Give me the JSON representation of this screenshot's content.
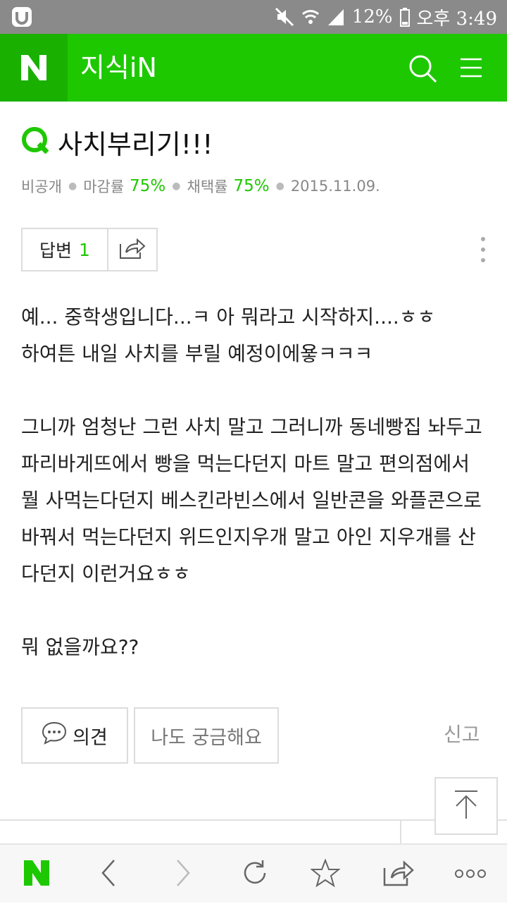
{
  "status_bar": {
    "battery": "12%",
    "time": "오후 3:49"
  },
  "header": {
    "logo": "N",
    "title": "지식iN"
  },
  "question": {
    "badge": "Q",
    "title": "사치부리기!!!",
    "meta": {
      "author": "비공개",
      "close_rate_label": "마감률",
      "close_rate": "75%",
      "adopt_rate_label": "채택률",
      "adopt_rate": "75%",
      "date": "2015.11.09."
    },
    "answer_label": "답변",
    "answer_count": "1",
    "body": "예... 중학생입니다...ㅋ 아 뭐라고 시작하지....ㅎㅎ\n하여튼 내일 사치를 부릴 예정이에욯ㅋㅋㅋ\n\n그니까 엄청난 그런 사치 말고 그러니까 동네빵집 놔두고 파리바게뜨에서 빵을 먹는다던지 마트 말고 편의점에서 뭘 사먹는다던지 베스킨라빈스에서 일반콘을 와플콘으로 바꿔서 먹는다던지 위드인지우개 말고 아인 지우개를 산다던지 이런거요ㅎㅎ\n\n뭐 없을까요??"
  },
  "actions": {
    "opinion": "의견",
    "curious": "나도 궁금해요",
    "report": "신고"
  },
  "bottom_nav": {
    "home_logo": "N"
  },
  "colors": {
    "naver_green": "#1ec800",
    "status_bar": "#8a8a8a"
  }
}
